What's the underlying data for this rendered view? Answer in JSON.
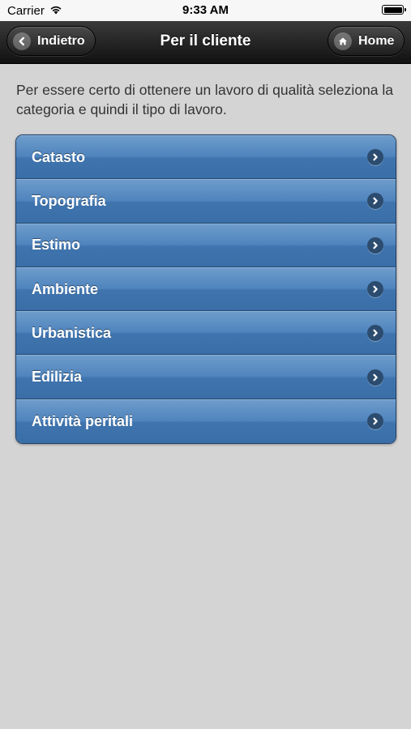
{
  "status_bar": {
    "carrier": "Carrier",
    "time": "9:33 AM"
  },
  "header": {
    "title": "Per il cliente",
    "back_label": "Indietro",
    "home_label": "Home"
  },
  "intro_text": "Per essere certo di ottenere un lavoro di qualità seleziona la categoria e quindi il tipo di lavoro.",
  "categories": [
    {
      "label": "Catasto"
    },
    {
      "label": "Topografia"
    },
    {
      "label": "Estimo"
    },
    {
      "label": "Ambiente"
    },
    {
      "label": "Urbanistica"
    },
    {
      "label": "Edilizia"
    },
    {
      "label": "Attività peritali"
    }
  ],
  "colors": {
    "list_blue": "#4f84bd",
    "header_dark": "#1e1e1e",
    "background": "#d4d4d4"
  }
}
